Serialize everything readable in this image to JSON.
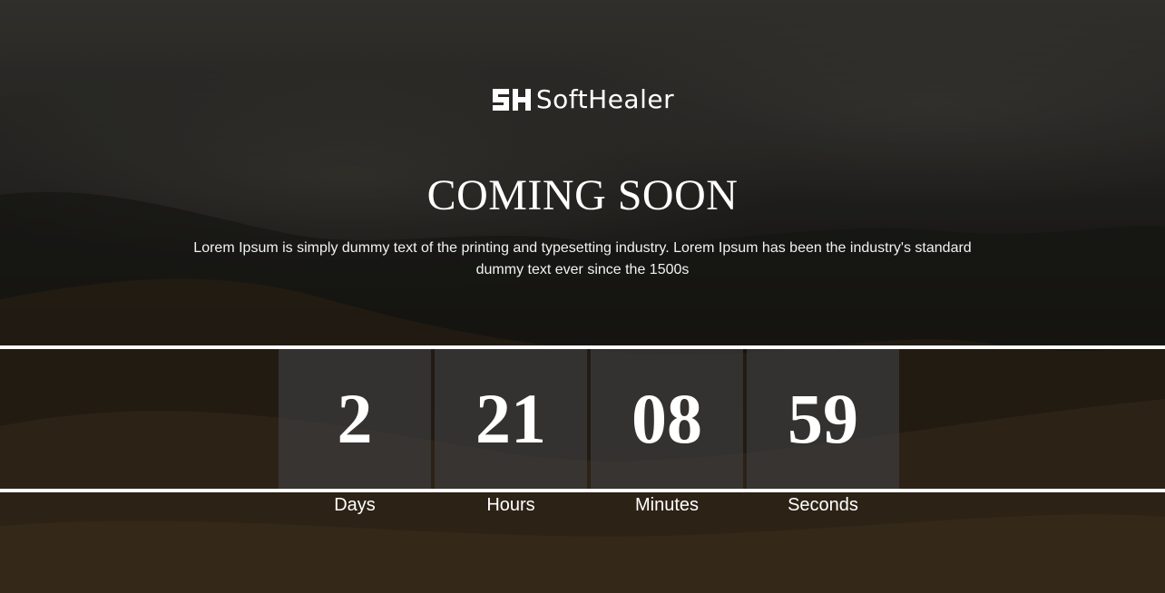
{
  "brand": {
    "logo_text": "SoftHealer",
    "mark_text": "SH"
  },
  "hero": {
    "title": "COMING SOON",
    "description": "Lorem Ipsum is simply dummy text of the printing and typesetting industry. Lorem Ipsum has been the industry's standard dummy text ever since the 1500s"
  },
  "countdown": [
    {
      "value": "2",
      "label": "Days"
    },
    {
      "value": "21",
      "label": "Hours"
    },
    {
      "value": "08",
      "label": "Minutes"
    },
    {
      "value": "59",
      "label": "Seconds"
    }
  ],
  "colors": {
    "text": "#ffffff",
    "box": "#3c3c3c",
    "divider": "#ffffff"
  }
}
